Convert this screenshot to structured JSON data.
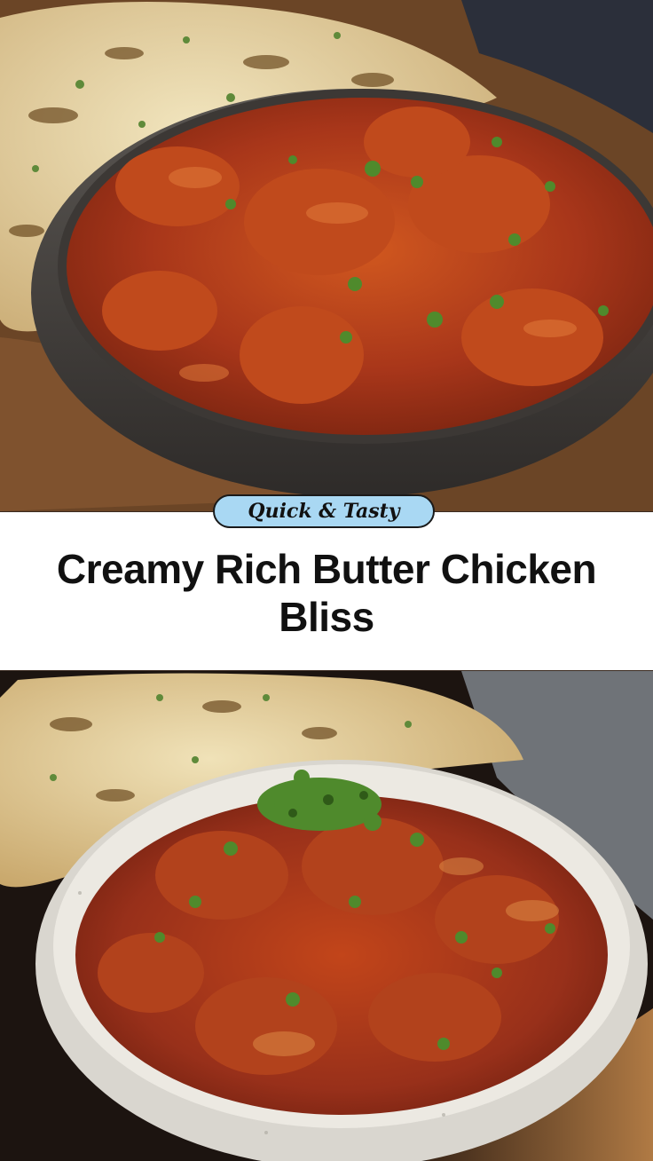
{
  "badge": {
    "label": "Quick & Tasty",
    "background": "#a9d8f3"
  },
  "title": "Creamy Rich Butter Chicken Bliss",
  "photos": [
    {
      "subject": "butter chicken in dark bowl with naan"
    },
    {
      "subject": "butter chicken in white speckled bowl with naan"
    }
  ],
  "colors": {
    "sauce": "#b8401a",
    "herb": "#4f8a2c",
    "naan": "#e8d8ab",
    "band": "#ffffff"
  }
}
